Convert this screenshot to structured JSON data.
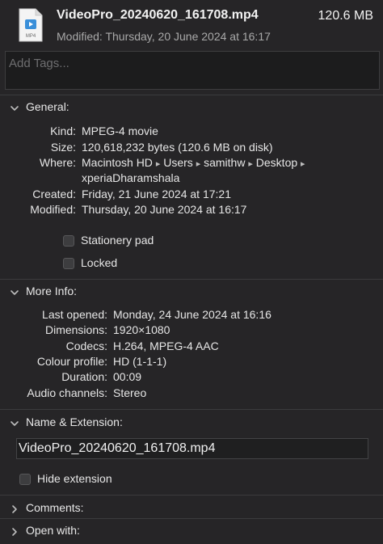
{
  "header": {
    "file_name": "VideoPro_20240620_161708.mp4",
    "file_size": "120.6 MB",
    "modified": "Modified: Thursday, 20 June 2024 at 16:17",
    "icon_caption": "MP4",
    "icon": "mp4-file-icon"
  },
  "tags": {
    "placeholder": "Add Tags..."
  },
  "general": {
    "title": "General:",
    "kind_label": "Kind:",
    "kind": "MPEG-4 movie",
    "size_label": "Size:",
    "size": "120,618,232 bytes (120.6 MB on disk)",
    "where_label": "Where:",
    "where_path": [
      "Macintosh HD",
      "Users",
      "samithw",
      "Desktop",
      "xperiaDharamshala"
    ],
    "path_separator": "▸",
    "created_label": "Created:",
    "created": "Friday, 21 June 2024 at 17:21",
    "modified_label": "Modified:",
    "modified": "Thursday, 20 June 2024 at 16:17",
    "stationery_label": "Stationery pad",
    "locked_label": "Locked"
  },
  "more_info": {
    "title": "More Info:",
    "last_opened_label": "Last opened:",
    "last_opened": "Monday, 24 June 2024 at 16:16",
    "dimensions_label": "Dimensions:",
    "dimensions": "1920×1080",
    "codecs_label": "Codecs:",
    "codecs": "H.264, MPEG-4 AAC",
    "colour_profile_label": "Colour profile:",
    "colour_profile": "HD (1-1-1)",
    "duration_label": "Duration:",
    "duration": "00:09",
    "audio_channels_label": "Audio channels:",
    "audio_channels": "Stereo"
  },
  "name_extension": {
    "title": "Name & Extension:",
    "file_name": "VideoPro_20240620_161708.mp4",
    "hide_extension_label": "Hide extension"
  },
  "comments": {
    "title": "Comments:"
  },
  "open_with": {
    "title": "Open with:"
  },
  "colors": {
    "background": "#262527",
    "text": "#e6e6e6",
    "secondary_text": "#a9a9a9",
    "field_background": "#1c1c1d",
    "divider": "#3b3b3d"
  }
}
